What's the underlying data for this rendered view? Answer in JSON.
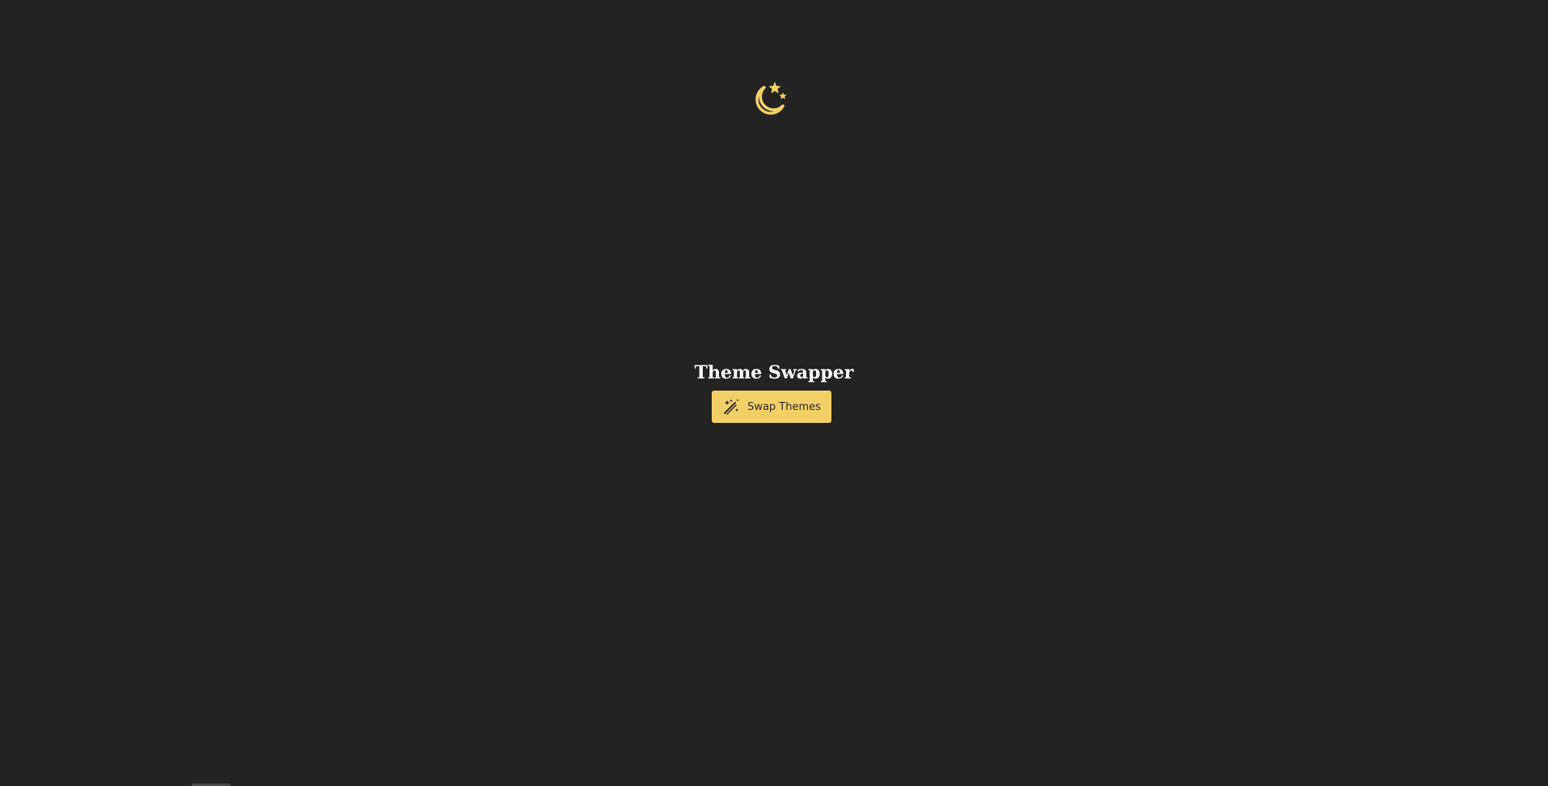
{
  "app": {
    "title": "Theme Swapper",
    "theme": "dark",
    "background_color": "#232323",
    "accent_color": "#f3d067",
    "title_color": "#ffffff"
  },
  "hero": {
    "icon": "moon-stars-icon"
  },
  "actions": {
    "swap_button": {
      "label": "Swap Themes",
      "icon": "wand-stars-icon"
    }
  }
}
